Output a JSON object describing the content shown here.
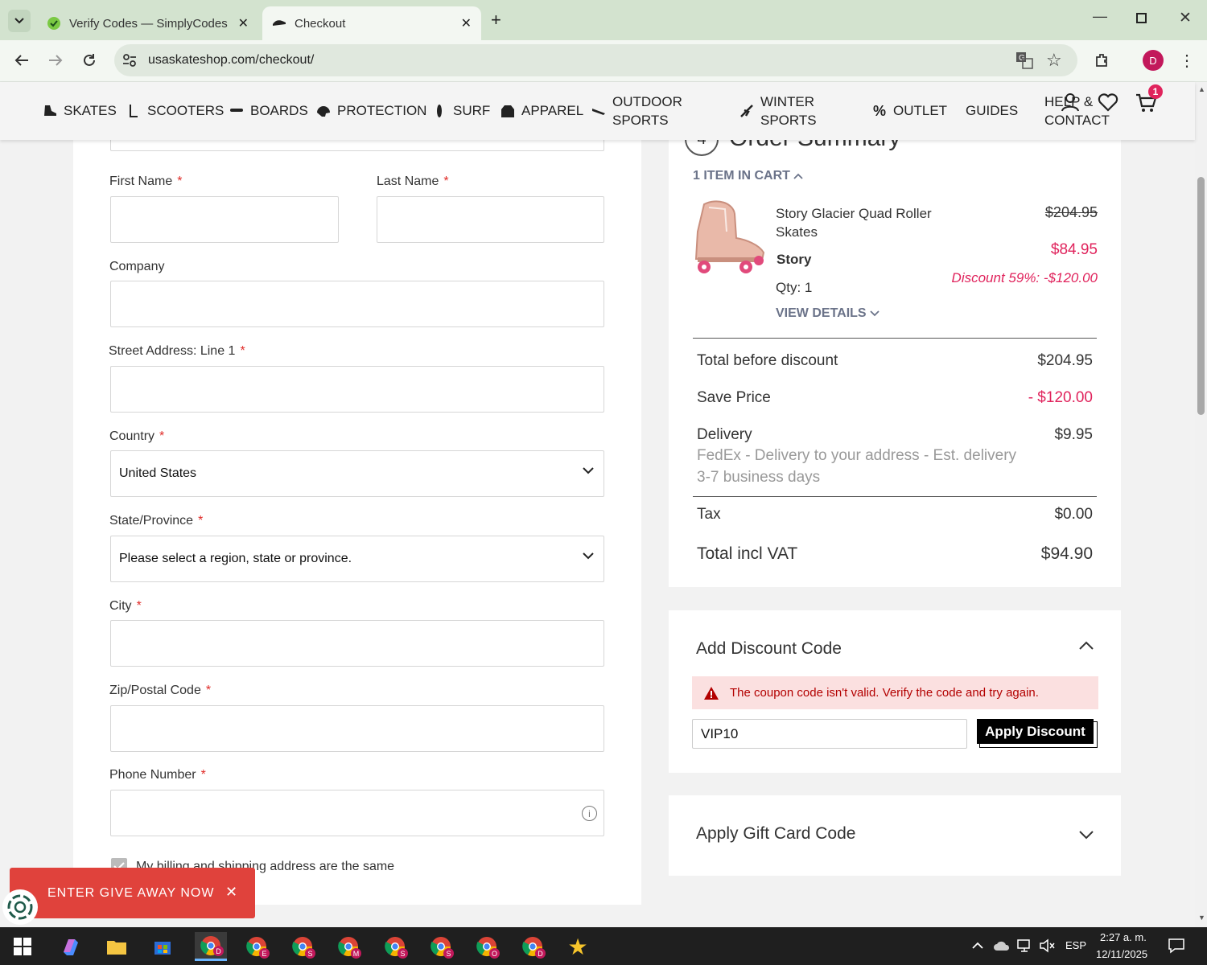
{
  "browser": {
    "tabs": [
      {
        "title": "Verify Codes — SimplyCodes",
        "active": false
      },
      {
        "title": "Checkout",
        "active": true
      }
    ],
    "url": "usaskateshop.com/checkout/",
    "profile_initial": "D",
    "accent": "#d3e3cf"
  },
  "site_nav": {
    "items": [
      {
        "label": "SKATES",
        "icon": "skate-icon"
      },
      {
        "label": "SCOOTERS",
        "icon": "scooter-icon"
      },
      {
        "label": "BOARDS",
        "icon": "board-icon"
      },
      {
        "label": "PROTECTION",
        "icon": "helmet-icon"
      },
      {
        "label": "SURF",
        "icon": "surfboard-icon"
      },
      {
        "label": "APPAREL",
        "icon": "hoodie-icon"
      },
      {
        "label": "OUTDOOR\nSPORTS",
        "icon": "outdoor-icon"
      },
      {
        "label": "WINTER\nSPORTS",
        "icon": "ski-icon"
      },
      {
        "label": "OUTLET",
        "icon": "percent-icon"
      },
      {
        "label": "GUIDES",
        "icon": ""
      },
      {
        "label": "HELP &\nCONTACT",
        "icon": ""
      }
    ],
    "cart_count": "1"
  },
  "form": {
    "first_name_label": "First Name",
    "last_name_label": "Last Name",
    "company_label": "Company",
    "street_label": "Street Address: Line 1",
    "country_label": "Country",
    "country_value": "United States",
    "state_label": "State/Province",
    "state_value": "Please select a region, state or province.",
    "city_label": "City",
    "zip_label": "Zip/Postal Code",
    "phone_label": "Phone Number",
    "required_mark": "*",
    "billing_same_label": "My billing and shipping address are the same"
  },
  "order_summary": {
    "title": "Order Summary",
    "step_number": "4",
    "items_in_cart": "1 ITEM IN CART",
    "product": {
      "name": "Story Glacier Quad Roller Skates",
      "brand": "Story",
      "qty": "Qty: 1",
      "view_details": "VIEW DETAILS",
      "old_price": "$204.95",
      "price": "$84.95",
      "discount": "Discount 59%: -$120.00"
    },
    "rows": {
      "total_before_label": "Total before discount",
      "total_before_value": "$204.95",
      "save_label": "Save Price",
      "save_value": "- $120.00",
      "delivery_label": "Delivery",
      "delivery_value": "$9.95",
      "delivery_desc": "FedEx - Delivery to your address - Est. delivery 3-7 business days",
      "tax_label": "Tax",
      "tax_value": "$0.00",
      "total_label": "Total incl VAT",
      "total_value": "$94.90"
    }
  },
  "discount": {
    "title": "Add Discount Code",
    "error": "The coupon code isn't valid. Verify the code and try again.",
    "code_value": "VIP10",
    "apply_label": "Apply Discount"
  },
  "gift_card": {
    "title": "Apply Gift Card Code"
  },
  "giveaway": {
    "label": "ENTER GIVE AWAY NOW"
  },
  "taskbar": {
    "lang": "ESP",
    "time": "2:27 a. m.",
    "date": "12/11/2025",
    "chrome_badges": [
      "D",
      "E",
      "S",
      "M",
      "S",
      "S",
      "O",
      "D"
    ]
  },
  "colors": {
    "sale_red": "#e0235c",
    "error_bg": "#fbe0e0",
    "error_text": "#b30000"
  }
}
